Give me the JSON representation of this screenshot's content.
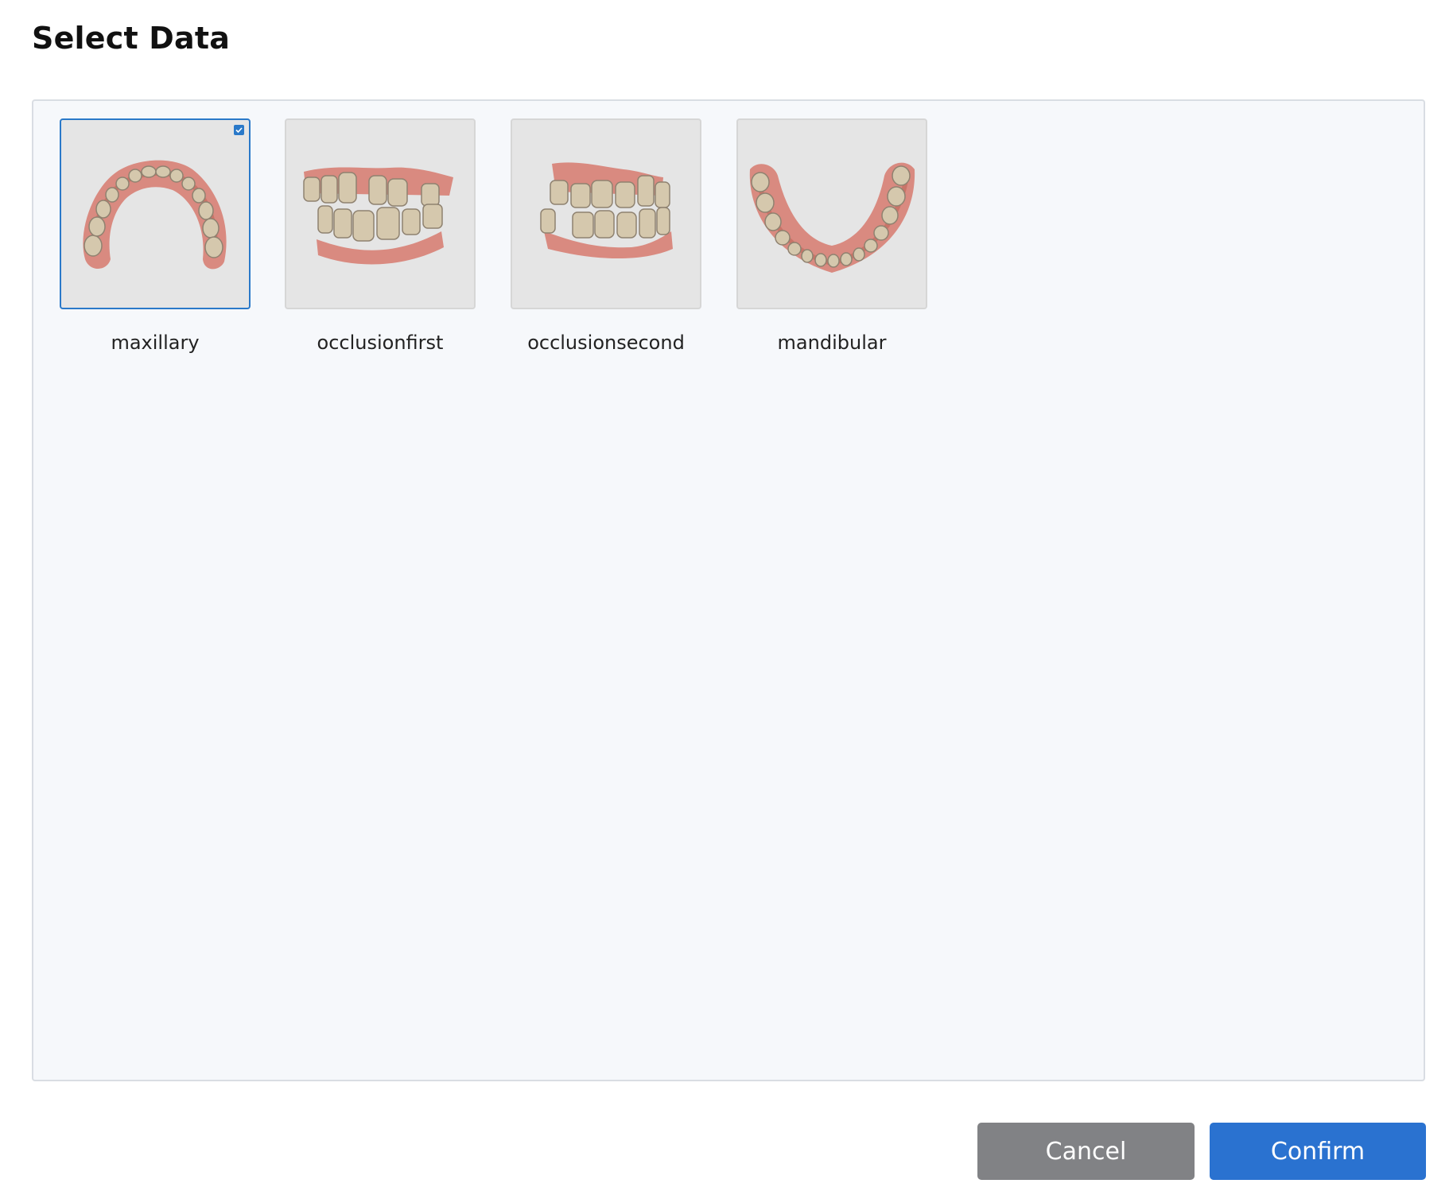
{
  "dialog": {
    "title": "Select Data"
  },
  "items": [
    {
      "label": "maxillary",
      "selected": true,
      "icon": "maxillary-arch-model-icon"
    },
    {
      "label": "occlusionfirst",
      "selected": false,
      "icon": "occlusion-first-model-icon"
    },
    {
      "label": "occlusionsecond",
      "selected": false,
      "icon": "occlusion-second-model-icon"
    },
    {
      "label": "mandibular",
      "selected": false,
      "icon": "mandibular-arch-model-icon"
    }
  ],
  "buttons": {
    "cancel_label": "Cancel",
    "confirm_label": "Confirm"
  },
  "colors": {
    "accent": "#2a72d0",
    "selected_border": "#2a79c9",
    "cancel_bg": "#818285",
    "gum": "#d98a80",
    "tooth": "#d8cdb5"
  }
}
